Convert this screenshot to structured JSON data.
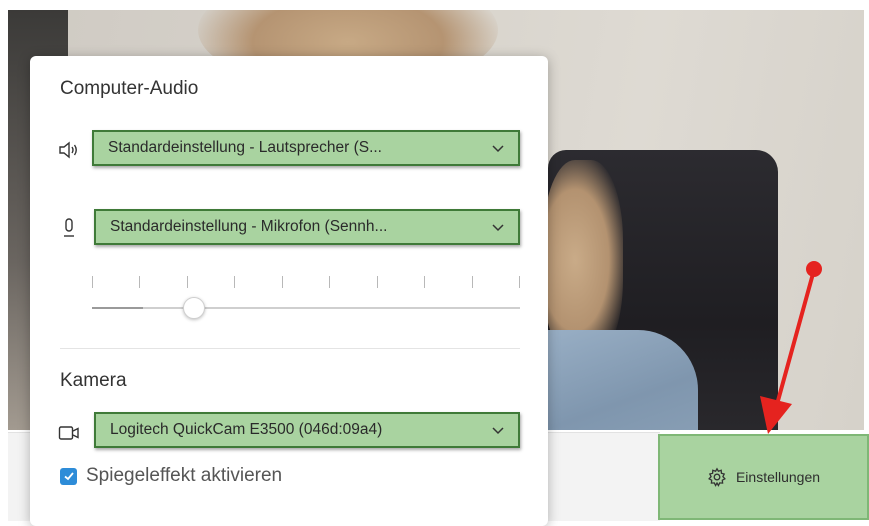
{
  "audio": {
    "title": "Computer-Audio",
    "speaker_select": "Standardeinstellung - Lautsprecher (S...",
    "mic_select": "Standardeinstellung - Mikrofon (Sennh...",
    "mic_level_fraction": 0.12
  },
  "camera": {
    "title": "Kamera",
    "camera_select": "Logitech QuickCam E3500 (046d:09a4)",
    "mirror_label": "Spiegeleffekt aktivieren",
    "mirror_checked": true
  },
  "settings_button": {
    "label": "Einstellungen"
  },
  "icons": {
    "speaker": "speaker-icon",
    "mic": "microphone-icon",
    "camera": "video-camera-icon",
    "chevron": "chevron-down-icon",
    "gear": "gear-icon",
    "check": "checkmark-icon"
  },
  "colors": {
    "highlight_fill": "#a9d3a0",
    "highlight_border": "#3f7a38",
    "checkbox": "#2d8cd8",
    "annotation_arrow": "#e5231f"
  }
}
